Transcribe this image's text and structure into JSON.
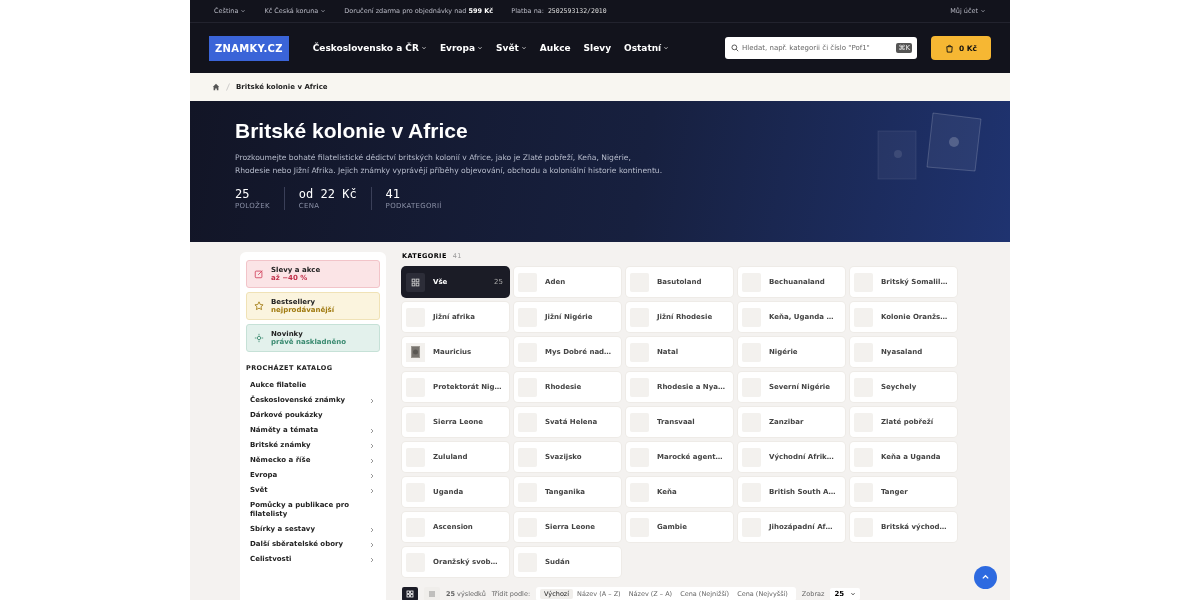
{
  "top_bar": {
    "language": "Čeština",
    "currency": "Kč Česká koruna",
    "shipping_note": "Doručení zdarma pro objednávky nad **599 Kč**",
    "payment_label": "Platba na:",
    "payment_account": "2502593132/2010",
    "account": "Můj účet"
  },
  "header": {
    "logo": "ZNAMKY.CZ",
    "nav": [
      {
        "label": "Československo a ČR",
        "dropdown": true
      },
      {
        "label": "Evropa",
        "dropdown": true
      },
      {
        "label": "Svět",
        "dropdown": true
      },
      {
        "label": "Aukce",
        "dropdown": false
      },
      {
        "label": "Slevy",
        "dropdown": false
      },
      {
        "label": "Ostatní",
        "dropdown": true
      }
    ],
    "search": {
      "placeholder": "Hledat, např. kategorii či číslo \"Pof1\"",
      "shortcut": "⌘K"
    },
    "cart": "0 Kč"
  },
  "breadcrumb": [
    "Britské kolonie v Africe"
  ],
  "hero": {
    "title": "Britské kolonie v Africe",
    "description": "Prozkoumejte bohaté filatelistické dědictví britských kolonií v Africe, jako je Zlaté pobřeží, Keňa, Nigérie, Rhodesie nebo Jižní Afrika. Jejich známky vyprávějí příběhy objevování, obchodu a koloniální historie kontinentu.",
    "stats": [
      {
        "value": "25",
        "label": "POLOŽEK"
      },
      {
        "value": "od 22 Kč",
        "label": "CENA"
      },
      {
        "value": "41",
        "label": "PODKATEGORIÍ"
      }
    ]
  },
  "sidebar": {
    "promos": [
      {
        "kind": "sale",
        "title": "Slevy a akce",
        "subtitle": "až −40 %"
      },
      {
        "kind": "bestseller",
        "title": "Bestsellery",
        "subtitle": "nejprodávanější"
      },
      {
        "kind": "new",
        "title": "Novinky",
        "subtitle": "právě naskladněno"
      }
    ],
    "catalog_title": "PROCHÁZET KATALOG",
    "items": [
      {
        "label": "Aukce filatelie",
        "expandable": false
      },
      {
        "label": "Československé známky",
        "expandable": true
      },
      {
        "label": "Dárkové poukázky",
        "expandable": false
      },
      {
        "label": "Náměty a témata",
        "expandable": true
      },
      {
        "label": "Britské známky",
        "expandable": true
      },
      {
        "label": "Německo a říše",
        "expandable": true
      },
      {
        "label": "Evropa",
        "expandable": true
      },
      {
        "label": "Svět",
        "expandable": true
      },
      {
        "label": "Pomůcky a publikace pro filatelisty",
        "expandable": false
      },
      {
        "label": "Sbírky a sestavy",
        "expandable": true
      },
      {
        "label": "Další sběratelské obory",
        "expandable": true
      },
      {
        "label": "Celistvosti",
        "expandable": true
      }
    ]
  },
  "categories": {
    "title": "KATEGORIE",
    "count": "41",
    "items": [
      {
        "kind": "all",
        "label": "Vše",
        "count": "25",
        "selected": true
      },
      {
        "label": "Aden",
        "selected": false
      },
      {
        "label": "Basutoland",
        "selected": false
      },
      {
        "label": "Bechuanaland",
        "selected": false
      },
      {
        "label": "Britský Somalil…",
        "selected": false
      },
      {
        "label": "Jižní afrika",
        "selected": false
      },
      {
        "label": "Jižní Nigérie",
        "selected": false
      },
      {
        "label": "Jižní Rhodesie",
        "selected": false
      },
      {
        "label": "Keňa, Uganda …",
        "selected": false
      },
      {
        "label": "Kolonie Oranžs…",
        "selected": false
      },
      {
        "kind": "picture",
        "label": "Mauricius",
        "selected": false
      },
      {
        "label": "Mys Dobré nad…",
        "selected": false
      },
      {
        "label": "Natal",
        "selected": false
      },
      {
        "label": "Nigérie",
        "selected": false
      },
      {
        "label": "Nyasaland",
        "selected": false
      },
      {
        "label": "Protektorát Nig…",
        "selected": false
      },
      {
        "label": "Rhodesie",
        "selected": false
      },
      {
        "label": "Rhodesie a Nya…",
        "selected": false
      },
      {
        "label": "Severní Nigérie",
        "selected": false
      },
      {
        "label": "Seychely",
        "selected": false
      },
      {
        "label": "Sierra Leone",
        "selected": false
      },
      {
        "label": "Svatá Helena",
        "selected": false
      },
      {
        "label": "Transvaal",
        "selected": false
      },
      {
        "label": "Zanzibar",
        "selected": false
      },
      {
        "label": "Zlaté pobřeží",
        "selected": false
      },
      {
        "label": "Zululand",
        "selected": false
      },
      {
        "label": "Svazijsko",
        "selected": false
      },
      {
        "label": "Marocké agent…",
        "selected": false
      },
      {
        "label": "Východní Afrik…",
        "selected": false
      },
      {
        "label": "Keňa a Uganda",
        "selected": false
      },
      {
        "label": "Uganda",
        "selected": false
      },
      {
        "label": "Tanganika",
        "selected": false
      },
      {
        "label": "Keňa",
        "selected": false
      },
      {
        "label": "British South A…",
        "selected": false
      },
      {
        "label": "Tanger",
        "selected": false
      },
      {
        "label": "Ascension",
        "selected": false
      },
      {
        "label": "Sierra Leone",
        "selected": false
      },
      {
        "label": "Gambie",
        "selected": false
      },
      {
        "label": "Jihozápadní Af…",
        "selected": false
      },
      {
        "label": "Britská východ…",
        "selected": false
      },
      {
        "label": "Oranžský svob…",
        "selected": false
      },
      {
        "label": "Sudán",
        "selected": false
      }
    ]
  },
  "toolbar": {
    "views": [
      {
        "kind": "grid",
        "selected": true
      },
      {
        "kind": "list",
        "selected": false
      }
    ],
    "results": "**25** výsledků",
    "sort_label": "Třídit podle:",
    "sort_options": [
      {
        "label": "Výchozí",
        "selected": true
      },
      {
        "label": "Název (A – Z)",
        "selected": false
      },
      {
        "label": "Název (Z – A)",
        "selected": false
      },
      {
        "label": "Cena (Nejnižší)",
        "selected": false
      },
      {
        "label": "Cena (Nejvyšší)",
        "selected": false
      }
    ],
    "show_label": "Zobraz",
    "per_page": "25"
  }
}
